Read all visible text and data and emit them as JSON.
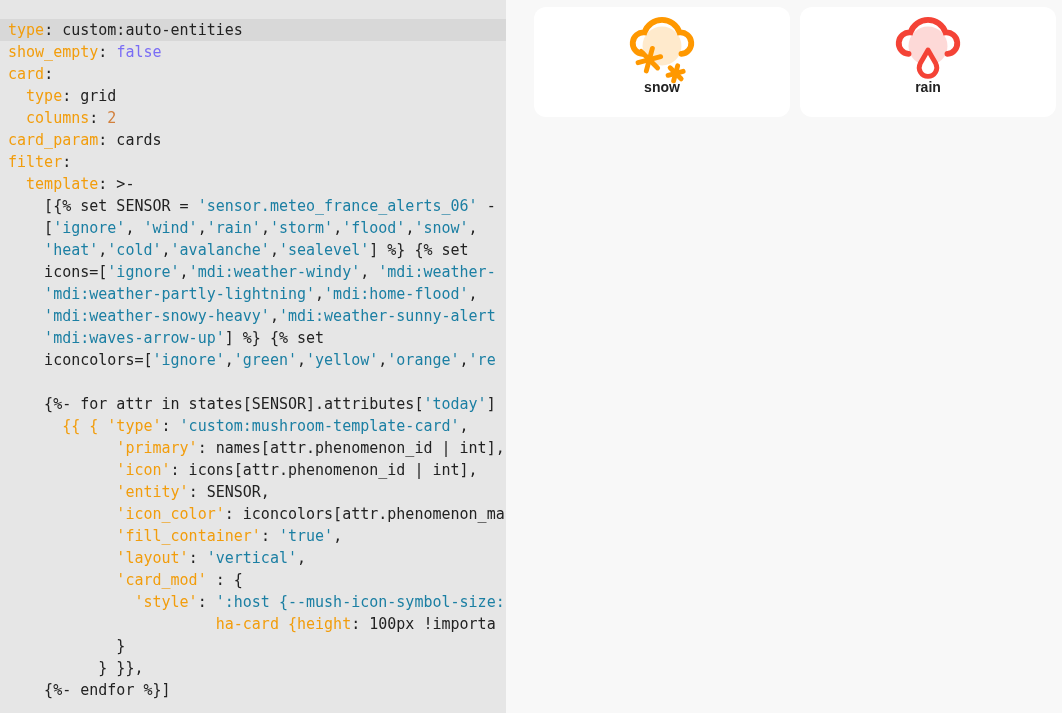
{
  "editor": {
    "lines": [
      {
        "selected": true,
        "tokens": [
          {
            "kind": "key",
            "text": "type"
          },
          {
            "kind": "plain",
            "text": ": custom:auto-entities"
          }
        ]
      },
      {
        "selected": false,
        "tokens": [
          {
            "kind": "key",
            "text": "show_empty"
          },
          {
            "kind": "plain",
            "text": ": "
          },
          {
            "kind": "bool",
            "text": "false"
          }
        ]
      },
      {
        "selected": false,
        "tokens": [
          {
            "kind": "key",
            "text": "card"
          },
          {
            "kind": "plain",
            "text": ":"
          }
        ]
      },
      {
        "selected": false,
        "tokens": [
          {
            "kind": "key",
            "text": "  type"
          },
          {
            "kind": "plain",
            "text": ": grid"
          }
        ]
      },
      {
        "selected": false,
        "tokens": [
          {
            "kind": "key",
            "text": "  columns"
          },
          {
            "kind": "plain",
            "text": ": "
          },
          {
            "kind": "number",
            "text": "2"
          }
        ]
      },
      {
        "selected": false,
        "tokens": [
          {
            "kind": "key",
            "text": "card_param"
          },
          {
            "kind": "plain",
            "text": ": cards"
          }
        ]
      },
      {
        "selected": false,
        "tokens": [
          {
            "kind": "key",
            "text": "filter"
          },
          {
            "kind": "plain",
            "text": ":"
          }
        ]
      },
      {
        "selected": false,
        "tokens": [
          {
            "kind": "key",
            "text": "  template"
          },
          {
            "kind": "plain",
            "text": ": >-"
          }
        ]
      },
      {
        "selected": false,
        "tokens": [
          {
            "kind": "plain",
            "text": "    [{% set SENSOR = "
          },
          {
            "kind": "string",
            "text": "'sensor.meteo_france_alerts_06'"
          },
          {
            "kind": "plain",
            "text": " -"
          }
        ]
      },
      {
        "selected": false,
        "tokens": [
          {
            "kind": "plain",
            "text": "    ["
          },
          {
            "kind": "string",
            "text": "'ignore'"
          },
          {
            "kind": "plain",
            "text": ", "
          },
          {
            "kind": "string",
            "text": "'wind'"
          },
          {
            "kind": "plain",
            "text": ","
          },
          {
            "kind": "string",
            "text": "'rain'"
          },
          {
            "kind": "plain",
            "text": ","
          },
          {
            "kind": "string",
            "text": "'storm'"
          },
          {
            "kind": "plain",
            "text": ","
          },
          {
            "kind": "string",
            "text": "'flood'"
          },
          {
            "kind": "plain",
            "text": ","
          },
          {
            "kind": "string",
            "text": "'snow'"
          },
          {
            "kind": "plain",
            "text": ","
          }
        ]
      },
      {
        "selected": false,
        "tokens": [
          {
            "kind": "string",
            "text": "    'heat'"
          },
          {
            "kind": "plain",
            "text": ","
          },
          {
            "kind": "string",
            "text": "'cold'"
          },
          {
            "kind": "plain",
            "text": ","
          },
          {
            "kind": "string",
            "text": "'avalanche'"
          },
          {
            "kind": "plain",
            "text": ","
          },
          {
            "kind": "string",
            "text": "'sealevel'"
          },
          {
            "kind": "plain",
            "text": "] %} {% set"
          }
        ]
      },
      {
        "selected": false,
        "tokens": [
          {
            "kind": "plain",
            "text": "    icons=["
          },
          {
            "kind": "string",
            "text": "'ignore'"
          },
          {
            "kind": "plain",
            "text": ","
          },
          {
            "kind": "string",
            "text": "'mdi:weather-windy'"
          },
          {
            "kind": "plain",
            "text": ", "
          },
          {
            "kind": "string",
            "text": "'mdi:weather-"
          }
        ]
      },
      {
        "selected": false,
        "tokens": [
          {
            "kind": "string",
            "text": "    'mdi:weather-partly-lightning'"
          },
          {
            "kind": "plain",
            "text": ","
          },
          {
            "kind": "string",
            "text": "'mdi:home-flood'"
          },
          {
            "kind": "plain",
            "text": ","
          }
        ]
      },
      {
        "selected": false,
        "tokens": [
          {
            "kind": "string",
            "text": "    'mdi:weather-snowy-heavy'"
          },
          {
            "kind": "plain",
            "text": ","
          },
          {
            "kind": "string",
            "text": "'mdi:weather-sunny-alert"
          }
        ]
      },
      {
        "selected": false,
        "tokens": [
          {
            "kind": "string",
            "text": "    'mdi:waves-arrow-up'"
          },
          {
            "kind": "plain",
            "text": "] %} {% set"
          }
        ]
      },
      {
        "selected": false,
        "tokens": [
          {
            "kind": "plain",
            "text": "    iconcolors=["
          },
          {
            "kind": "string",
            "text": "'ignore'"
          },
          {
            "kind": "plain",
            "text": ","
          },
          {
            "kind": "string",
            "text": "'green'"
          },
          {
            "kind": "plain",
            "text": ","
          },
          {
            "kind": "string",
            "text": "'yellow'"
          },
          {
            "kind": "plain",
            "text": ","
          },
          {
            "kind": "string",
            "text": "'orange'"
          },
          {
            "kind": "plain",
            "text": ","
          },
          {
            "kind": "string",
            "text": "'re"
          }
        ]
      },
      {
        "selected": false
      },
      {
        "selected": false,
        "tokens": [
          {
            "kind": "plain",
            "text": "    {%- for attr in states[SENSOR].attributes["
          },
          {
            "kind": "string",
            "text": "'today'"
          },
          {
            "kind": "plain",
            "text": "]"
          }
        ]
      },
      {
        "selected": false,
        "tokens": [
          {
            "kind": "key",
            "text": "      {{ { 'type'"
          },
          {
            "kind": "plain",
            "text": ": "
          },
          {
            "kind": "string",
            "text": "'custom:mushroom-template-card'"
          },
          {
            "kind": "plain",
            "text": ","
          }
        ]
      },
      {
        "selected": false,
        "tokens": [
          {
            "kind": "key",
            "text": "            'primary'"
          },
          {
            "kind": "plain",
            "text": ": names[attr.phenomenon_id | int],"
          }
        ]
      },
      {
        "selected": false,
        "tokens": [
          {
            "kind": "key",
            "text": "            'icon'"
          },
          {
            "kind": "plain",
            "text": ": icons[attr.phenomenon_id | int],"
          }
        ]
      },
      {
        "selected": false,
        "tokens": [
          {
            "kind": "key",
            "text": "            'entity'"
          },
          {
            "kind": "plain",
            "text": ": SENSOR,"
          }
        ]
      },
      {
        "selected": false,
        "tokens": [
          {
            "kind": "key",
            "text": "            'icon_color'"
          },
          {
            "kind": "plain",
            "text": ": iconcolors[attr.phenomenon_ma"
          }
        ]
      },
      {
        "selected": false,
        "tokens": [
          {
            "kind": "key",
            "text": "            'fill_container'"
          },
          {
            "kind": "plain",
            "text": ": "
          },
          {
            "kind": "string",
            "text": "'true'"
          },
          {
            "kind": "plain",
            "text": ","
          }
        ]
      },
      {
        "selected": false,
        "tokens": [
          {
            "kind": "key",
            "text": "            'layout'"
          },
          {
            "kind": "plain",
            "text": ": "
          },
          {
            "kind": "string",
            "text": "'vertical'"
          },
          {
            "kind": "plain",
            "text": ","
          }
        ]
      },
      {
        "selected": false,
        "tokens": [
          {
            "kind": "key",
            "text": "            'card_mod'"
          },
          {
            "kind": "plain",
            "text": " : {"
          }
        ]
      },
      {
        "selected": false,
        "tokens": [
          {
            "kind": "key",
            "text": "              'style'"
          },
          {
            "kind": "plain",
            "text": ": "
          },
          {
            "kind": "string",
            "text": "':host {--mush-icon-symbol-size:"
          }
        ]
      },
      {
        "selected": false,
        "tokens": [
          {
            "kind": "key",
            "text": "                       ha-card {height"
          },
          {
            "kind": "plain",
            "text": ": 100px !importa"
          }
        ]
      },
      {
        "selected": false,
        "tokens": [
          {
            "kind": "plain",
            "text": "            }"
          }
        ]
      },
      {
        "selected": false,
        "tokens": [
          {
            "kind": "plain",
            "text": "          } }},"
          }
        ]
      },
      {
        "selected": false,
        "tokens": [
          {
            "kind": "plain",
            "text": "    {%- endfor %}]"
          }
        ]
      }
    ]
  },
  "cards": [
    {
      "name": "snow",
      "kind": "snow",
      "color": "#ff9800"
    },
    {
      "name": "rain",
      "kind": "rain",
      "color": "#f44336"
    }
  ]
}
